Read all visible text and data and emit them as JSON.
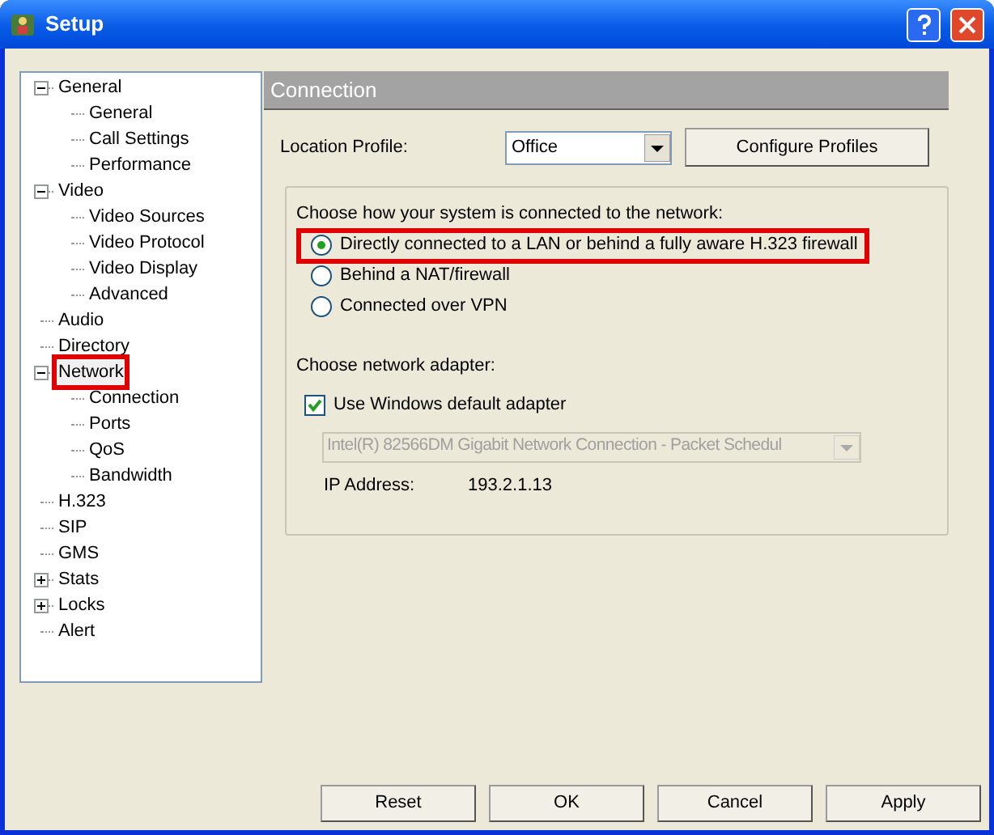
{
  "window": {
    "title": "Setup"
  },
  "tree": [
    {
      "label": "General",
      "expanded": true,
      "highlighted": false,
      "children": [
        {
          "label": "General"
        },
        {
          "label": "Call Settings"
        },
        {
          "label": "Performance"
        }
      ]
    },
    {
      "label": "Video",
      "expanded": true,
      "highlighted": false,
      "children": [
        {
          "label": "Video Sources"
        },
        {
          "label": "Video Protocol"
        },
        {
          "label": "Video Display"
        },
        {
          "label": "Advanced"
        }
      ]
    },
    {
      "label": "Audio",
      "highlighted": false
    },
    {
      "label": "Directory",
      "highlighted": false
    },
    {
      "label": "Network",
      "expanded": true,
      "highlighted": true,
      "children": [
        {
          "label": "Connection"
        },
        {
          "label": "Ports"
        },
        {
          "label": "QoS"
        },
        {
          "label": "Bandwidth"
        }
      ]
    },
    {
      "label": "H.323",
      "highlighted": false
    },
    {
      "label": "SIP",
      "highlighted": false
    },
    {
      "label": "GMS",
      "highlighted": false
    },
    {
      "label": "Stats",
      "expanded": false,
      "highlighted": false
    },
    {
      "label": "Locks",
      "expanded": false,
      "highlighted": false
    },
    {
      "label": "Alert",
      "highlighted": false
    }
  ],
  "panel": {
    "title": "Connection",
    "location_profile": {
      "label": "Location Profile:",
      "value": "Office"
    },
    "configure_button": "Configure Profiles",
    "connection_prompt": "Choose how your system is connected to the network:",
    "connection_options": [
      {
        "label": "Directly connected to a LAN or behind a fully aware H.323 firewall",
        "selected": true,
        "highlighted": true
      },
      {
        "label": "Behind a NAT/firewall",
        "selected": false,
        "highlighted": false
      },
      {
        "label": "Connected over VPN",
        "selected": false,
        "highlighted": false
      }
    ],
    "adapter_prompt": "Choose network adapter:",
    "default_adapter": {
      "label": "Use Windows default adapter",
      "checked": true
    },
    "adapter": {
      "value": "Intel(R) 82566DM Gigabit Network Connection - Packet Schedul",
      "disabled": true
    },
    "ip_address": {
      "label": "IP Address:",
      "value": "193.2.1.13"
    }
  },
  "buttons": [
    "Reset",
    "OK",
    "Cancel",
    "Apply"
  ]
}
